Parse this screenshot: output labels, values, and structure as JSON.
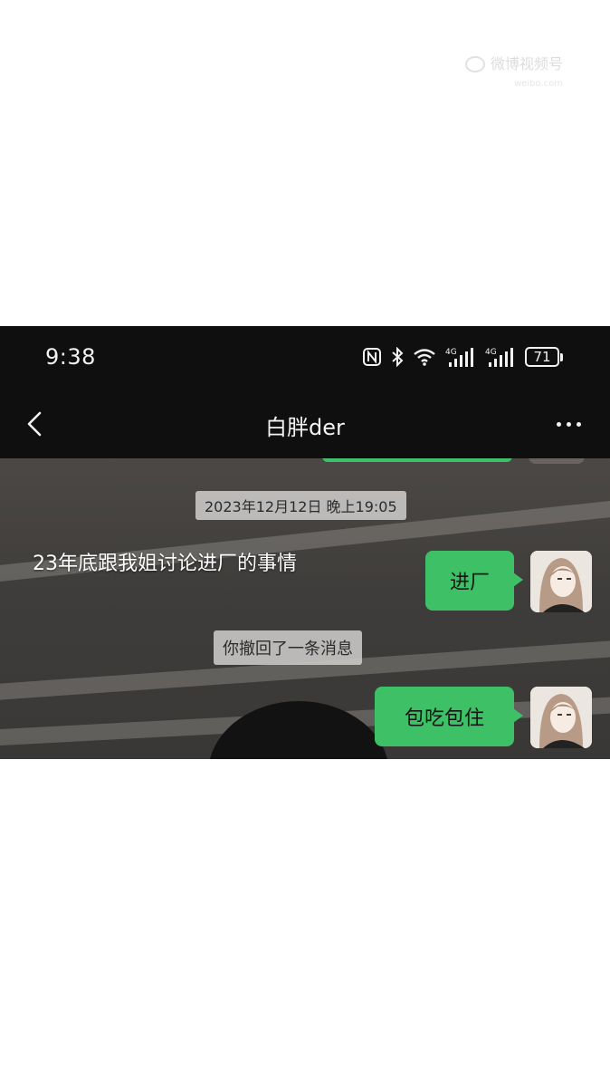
{
  "watermark": {
    "text": "微博视频号",
    "sub": "weibo.com"
  },
  "statusbar": {
    "time": "9:38",
    "icons": [
      "nfc-icon",
      "bluetooth-icon",
      "wifi-icon",
      "signal-4g-icon",
      "signal-4g-icon"
    ],
    "network_label_1": "4G",
    "network_label_2": "4G",
    "battery": "71"
  },
  "navbar": {
    "back_icon": "chevron-left-icon",
    "title": "白胖der",
    "more_icon": "more-icon"
  },
  "chat": {
    "timestamp": "2023年12月12日 晚上19:05",
    "caption": "23年底跟我姐讨论进厂的事情",
    "messages": [
      {
        "text": "进厂",
        "sender": "me"
      },
      {
        "text": "包吃包住",
        "sender": "me"
      }
    ],
    "recall_notice": "你撤回了一条消息"
  },
  "colors": {
    "bubble": "#3dc066",
    "bar": "#0f0f0f",
    "page": "#ffffff"
  }
}
